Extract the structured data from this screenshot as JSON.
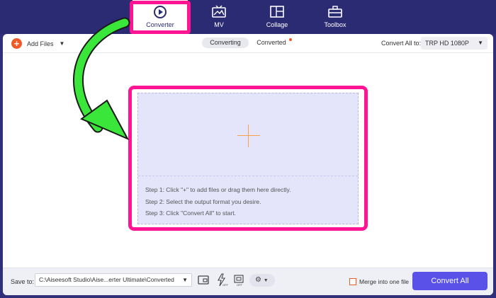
{
  "nav": {
    "tabs": [
      {
        "label": "Converter",
        "icon": "converter-icon",
        "active": true
      },
      {
        "label": "MV",
        "icon": "mv-icon"
      },
      {
        "label": "Collage",
        "icon": "collage-icon"
      },
      {
        "label": "Toolbox",
        "icon": "toolbox-icon"
      }
    ]
  },
  "toolbar": {
    "add_files": "Add Files",
    "tabs": [
      {
        "label": "Converting",
        "active": true
      },
      {
        "label": "Converted",
        "badge": true
      }
    ],
    "convert_all_label": "Convert All to:",
    "format": "TRP HD 1080P"
  },
  "dropzone": {
    "steps": [
      "Step 1: Click \"+\" to add files or drag them here directly.",
      "Step 2: Select the output format you desire.",
      "Step 3: Click \"Convert All\" to start."
    ]
  },
  "bottom": {
    "save_to_label": "Save to:",
    "save_path": "C:\\Aiseesoft Studio\\Aise...erter Ultimate\\Converted",
    "merge_label": "Merge into one file",
    "convert_all_button": "Convert All"
  },
  "colors": {
    "accent": "#5a51e8",
    "highlight": "#ff1493",
    "nav_bg": "#2b2b73",
    "add_icon": "#f05a28",
    "arrow": "#39e639"
  }
}
